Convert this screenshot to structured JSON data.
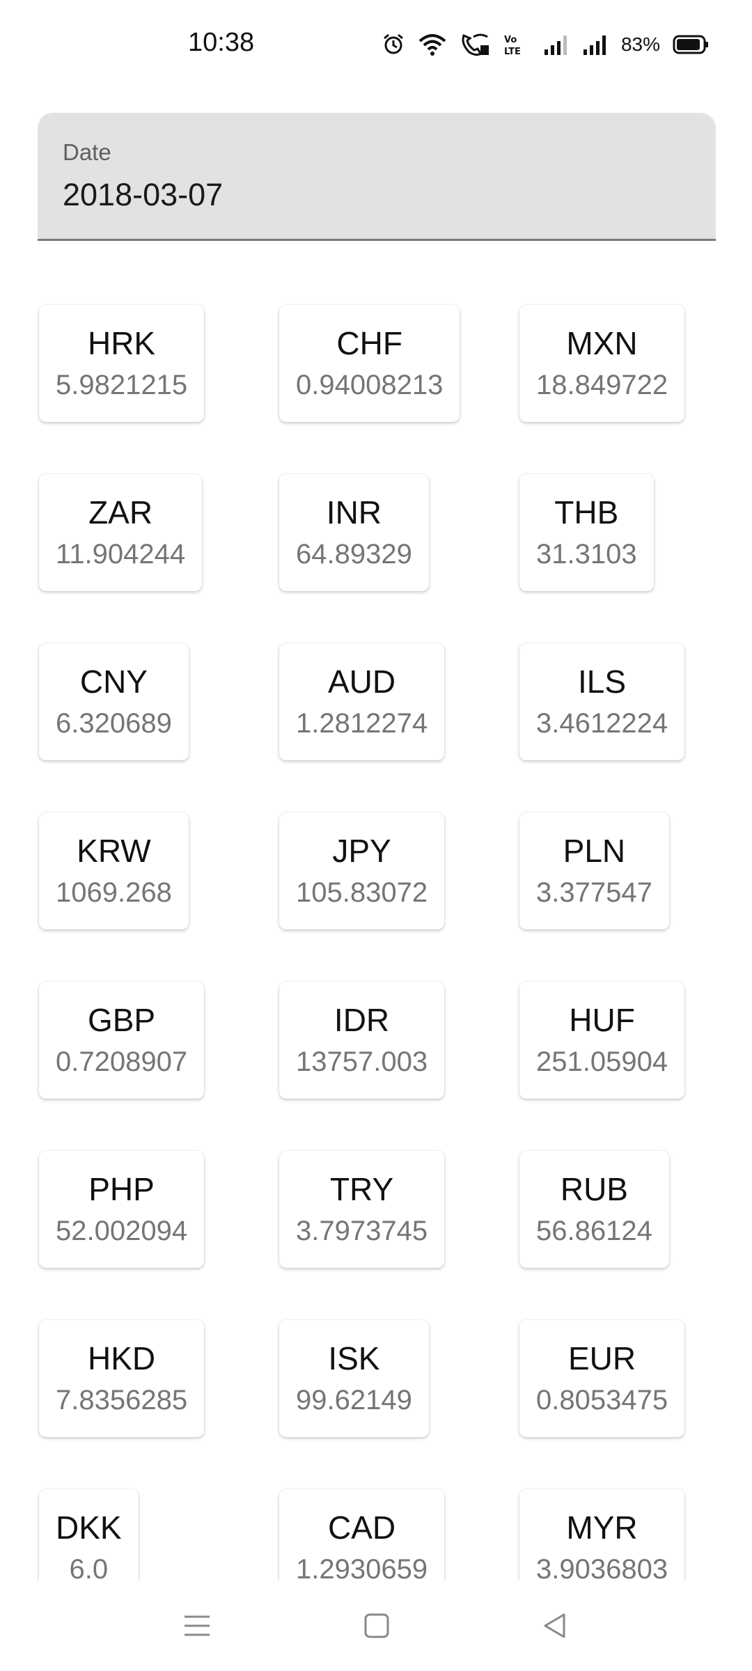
{
  "status_bar": {
    "time": "10:38",
    "battery_percent": "83%",
    "icons": [
      "alarm-icon",
      "wifi-icon",
      "wifi-calling-icon",
      "volte-icon",
      "signal-icon",
      "signal-icon",
      "battery-icon"
    ]
  },
  "date_field": {
    "label": "Date",
    "value": "2018-03-07"
  },
  "rates": [
    {
      "code": "HRK",
      "rate": "5.9821215"
    },
    {
      "code": "CHF",
      "rate": "0.94008213"
    },
    {
      "code": "MXN",
      "rate": "18.849722"
    },
    {
      "code": "ZAR",
      "rate": "11.904244"
    },
    {
      "code": "INR",
      "rate": "64.89329"
    },
    {
      "code": "THB",
      "rate": "31.3103"
    },
    {
      "code": "CNY",
      "rate": "6.320689"
    },
    {
      "code": "AUD",
      "rate": "1.2812274"
    },
    {
      "code": "ILS",
      "rate": "3.4612224"
    },
    {
      "code": "KRW",
      "rate": "1069.268"
    },
    {
      "code": "JPY",
      "rate": "105.83072"
    },
    {
      "code": "PLN",
      "rate": "3.377547"
    },
    {
      "code": "GBP",
      "rate": "0.7208907"
    },
    {
      "code": "IDR",
      "rate": "13757.003"
    },
    {
      "code": "HUF",
      "rate": "251.05904"
    },
    {
      "code": "PHP",
      "rate": "52.002094"
    },
    {
      "code": "TRY",
      "rate": "3.7973745"
    },
    {
      "code": "RUB",
      "rate": "56.86124"
    },
    {
      "code": "HKD",
      "rate": "7.8356285"
    },
    {
      "code": "ISK",
      "rate": "99.62149"
    },
    {
      "code": "EUR",
      "rate": "0.8053475"
    },
    {
      "code": "DKK",
      "rate": "6.0"
    },
    {
      "code": "CAD",
      "rate": "1.2930659"
    },
    {
      "code": "MYR",
      "rate": "3.9036803"
    }
  ],
  "nav_bar": {
    "buttons": [
      "menu-icon",
      "home-icon",
      "back-icon"
    ]
  },
  "colors": {
    "date_field_bg": "#e2e2e2",
    "rate_text": "#757575",
    "card_bg": "#ffffff"
  }
}
